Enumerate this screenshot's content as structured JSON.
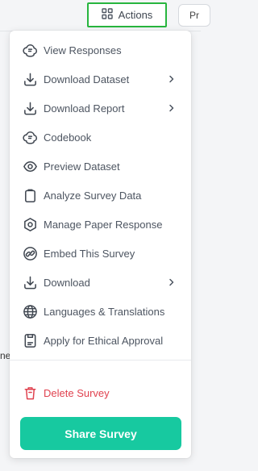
{
  "toolbar": {
    "actions_label": "Actions",
    "partial_button_label": "Pr"
  },
  "background": {
    "edge_text": "ne"
  },
  "menu": {
    "items": [
      {
        "label": "View Responses",
        "icon": "cloud-doc-icon",
        "submenu": false
      },
      {
        "label": "Download Dataset",
        "icon": "download-icon",
        "submenu": true
      },
      {
        "label": "Download Report",
        "icon": "download-icon",
        "submenu": true
      },
      {
        "label": "Codebook",
        "icon": "codebook-icon",
        "submenu": false
      },
      {
        "label": "Preview Dataset",
        "icon": "eye-icon",
        "submenu": false
      },
      {
        "label": "Analyze Survey Data",
        "icon": "clipboard-icon",
        "submenu": false
      },
      {
        "label": "Manage Paper Response",
        "icon": "hexagon-gear-icon",
        "submenu": false
      },
      {
        "label": "Embed This Survey",
        "icon": "link-icon",
        "submenu": false
      },
      {
        "label": "Download",
        "icon": "download-icon",
        "submenu": true
      },
      {
        "label": "Languages & Translations",
        "icon": "globe-icon",
        "submenu": false
      },
      {
        "label": "Apply for Ethical Approval",
        "icon": "approval-doc-icon",
        "submenu": false
      }
    ],
    "delete_label": "Delete Survey",
    "share_label": "Share Survey"
  },
  "colors": {
    "accent_green": "#17c9a0",
    "highlight_border": "#27b53e",
    "danger": "#e0424f"
  }
}
